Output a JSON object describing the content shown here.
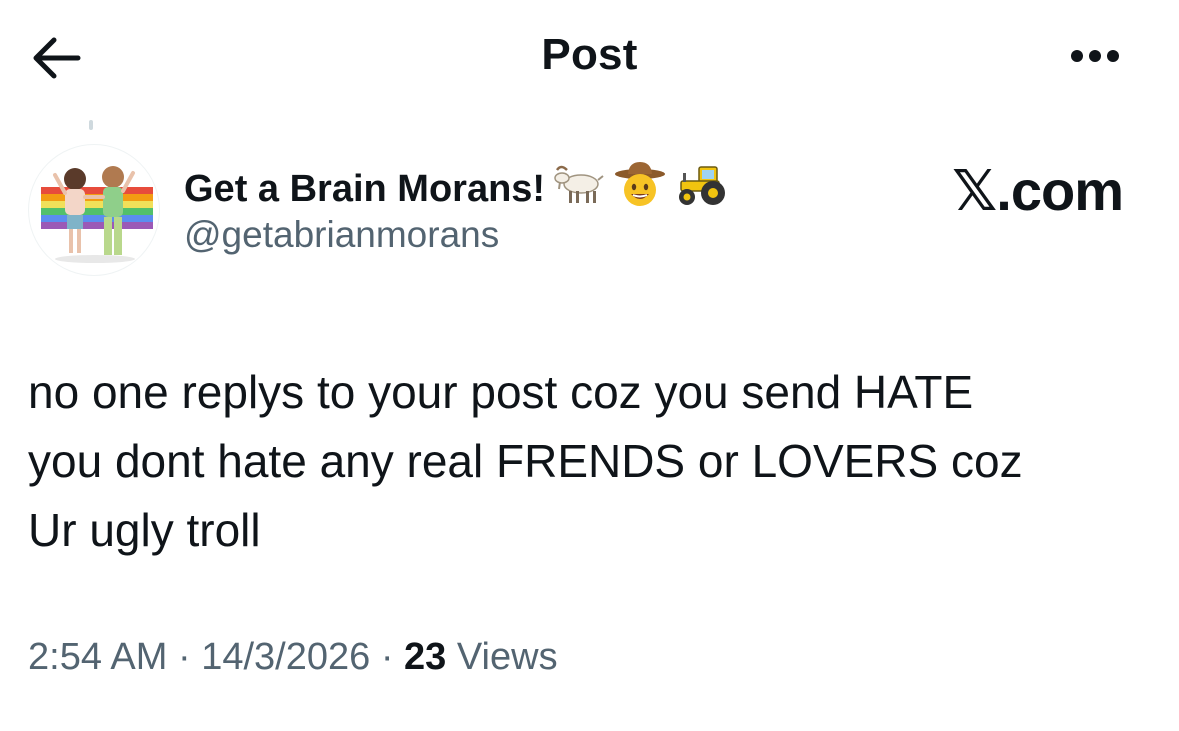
{
  "header": {
    "title": "Post",
    "back_icon": "arrow-left-icon",
    "more_icon": "more-horizontal-icon"
  },
  "author": {
    "display_name": "Get a Brain Morans!",
    "name_emojis": [
      "goat-icon",
      "cowboy-face-icon",
      "tractor-icon"
    ],
    "handle": "@getabrianmorans",
    "avatar": "rainbow-flag-couple-avatar"
  },
  "brand": {
    "x_glyph": "𝕏",
    "suffix": ".com"
  },
  "post": {
    "line1": "no one replys to your post coz you send HATE",
    "line2": "you dont hate any real FRENDS or LOVERS coz",
    "line3": "Ur ugly troll"
  },
  "meta": {
    "time": "2:54 AM",
    "sep1": " · ",
    "date": "14/3/2026",
    "sep2": " · ",
    "views_count": "23",
    "views_label": " Views"
  },
  "colors": {
    "text_primary": "#0f1419",
    "text_secondary": "#536471"
  }
}
